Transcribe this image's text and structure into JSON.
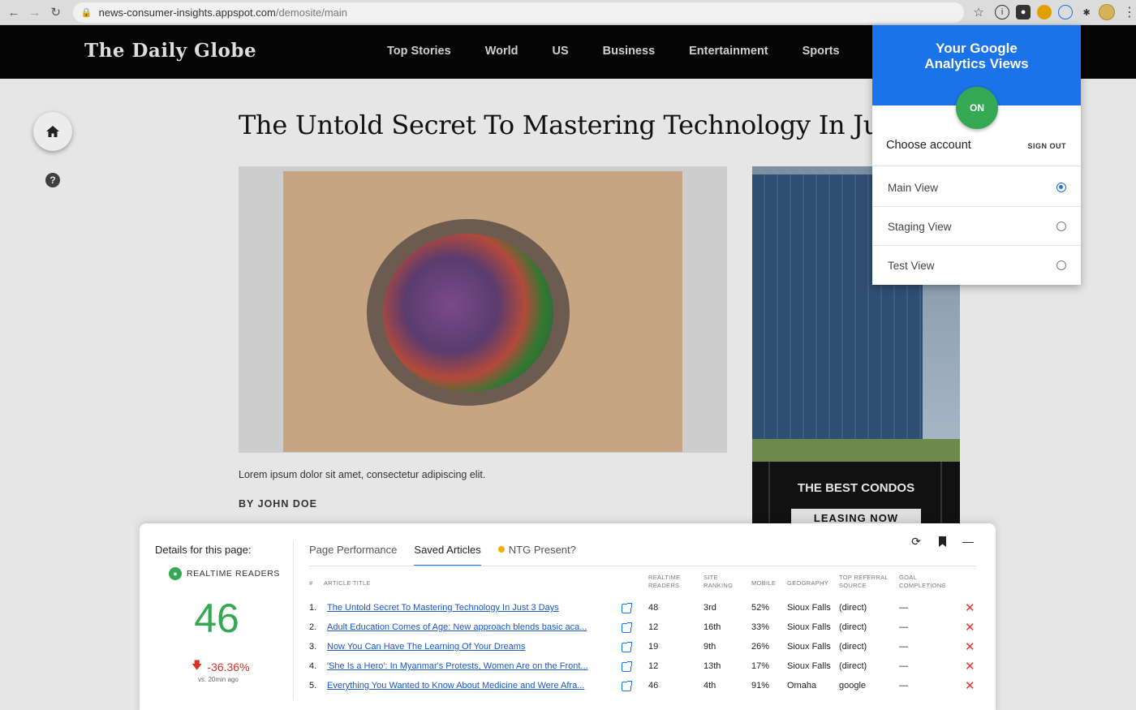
{
  "browser": {
    "url_host": "news-consumer-insights.appspot.com",
    "url_path": "/demosite/main"
  },
  "site": {
    "logo": "The Daily Globe",
    "nav": [
      "Top Stories",
      "World",
      "US",
      "Business",
      "Entertainment",
      "Sports"
    ]
  },
  "article": {
    "headline": "The Untold Secret To Mastering Technology In Just",
    "caption": "Lorem ipsum dolor sit amet, consectetur adipiscing elit.",
    "byline": "BY JOHN DOE"
  },
  "ad": {
    "title": "THE BEST CONDOS",
    "cta": "LEASING NOW"
  },
  "popup": {
    "title_line1": "Your Google",
    "title_line2": "Analytics Views",
    "toggle": "ON",
    "choose_account": "Choose account",
    "sign_out": "SIGN OUT",
    "views": [
      {
        "label": "Main View",
        "selected": true
      },
      {
        "label": "Staging View",
        "selected": false
      },
      {
        "label": "Test View",
        "selected": false
      }
    ]
  },
  "panel": {
    "details_title": "Details for this page:",
    "realtime_label": "REALTIME READERS",
    "realtime_value": "46",
    "delta": "-36.36%",
    "delta_sub": "vs. 20min ago",
    "tabs": [
      "Page Performance",
      "Saved Articles",
      "NTG Present?"
    ],
    "active_tab": 1,
    "columns": {
      "num": "#",
      "title": "ARTICLE TITLE",
      "readers_1": "REALTIME",
      "readers_2": "READERS",
      "rank_1": "SITE",
      "rank_2": "RANKING",
      "mobile": "MOBILE",
      "geo": "GEOGRAPHY",
      "ref_1": "TOP REFERRAL",
      "ref_2": "SOURCE",
      "goal_1": "GOAL",
      "goal_2": "COMPLETIONS"
    },
    "rows": [
      {
        "num": "1.",
        "title": "The Untold Secret To Mastering Technology In Just 3 Days",
        "readers": "48",
        "rank": "3rd",
        "mobile": "52%",
        "geo": "Sioux Falls",
        "ref": "(direct)",
        "goal": "—"
      },
      {
        "num": "2.",
        "title": "Adult Education Comes of Age: New approach blends basic aca...",
        "readers": "12",
        "rank": "16th",
        "mobile": "33%",
        "geo": "Sioux Falls",
        "ref": "(direct)",
        "goal": "—"
      },
      {
        "num": "3.",
        "title": "Now You Can Have The Learning Of Your Dreams",
        "readers": "19",
        "rank": "9th",
        "mobile": "26%",
        "geo": "Sioux Falls",
        "ref": "(direct)",
        "goal": "—"
      },
      {
        "num": "4.",
        "title": "'She Is a Hero': In Myanmar's Protests, Women Are on the Front...",
        "readers": "12",
        "rank": "13th",
        "mobile": "17%",
        "geo": "Sioux Falls",
        "ref": "(direct)",
        "goal": "—"
      },
      {
        "num": "5.",
        "title": "Everything You Wanted to Know About Medicine and Were Afra...",
        "readers": "46",
        "rank": "4th",
        "mobile": "91%",
        "geo": "Omaha",
        "ref": "google",
        "goal": "—"
      }
    ]
  },
  "colors": {
    "accent": "#1a73e8",
    "positive": "#34a853",
    "negative": "#d93025",
    "warning": "#f9ab00"
  },
  "icons": [
    "back-icon",
    "forward-icon",
    "reload-icon",
    "lock-icon",
    "star-icon",
    "home-icon",
    "help-icon",
    "refresh-icon",
    "bookmark-icon",
    "minimize-icon",
    "external-link-icon",
    "delete-icon",
    "person-icon",
    "arrow-down-icon"
  ]
}
